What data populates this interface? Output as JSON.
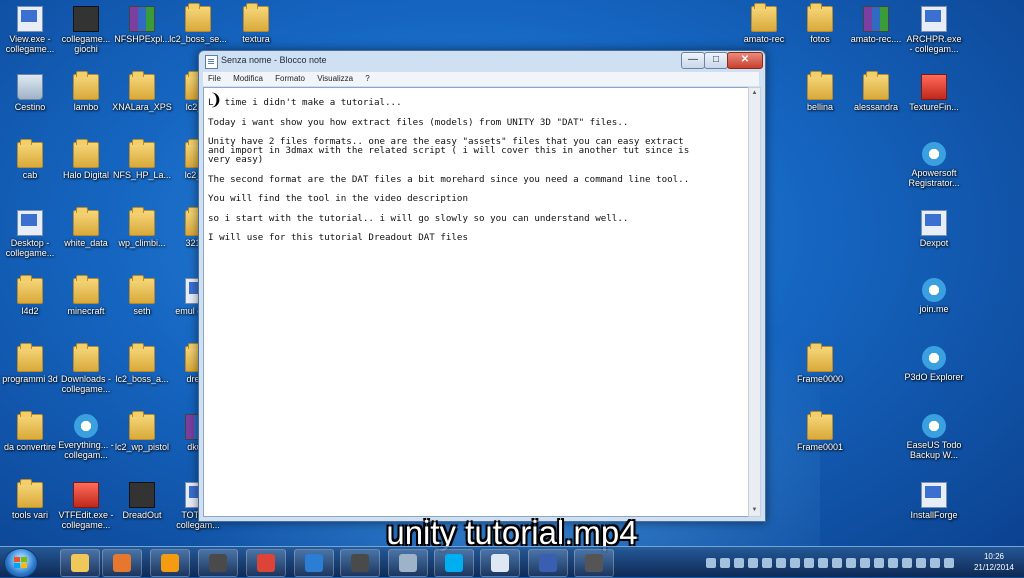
{
  "desktop": {
    "left_icons": [
      {
        "label": "View.exe - collegame...",
        "icon": "exe"
      },
      {
        "label": "collegame... giochi",
        "icon": "dark"
      },
      {
        "label": "NFSHPExpl...",
        "icon": "rar"
      },
      {
        "label": "lc2_boss_se...",
        "icon": "folder"
      },
      {
        "label": "textura",
        "icon": "folder"
      },
      {
        "label": "Cestino",
        "icon": "bin"
      },
      {
        "label": "lambo",
        "icon": "folder"
      },
      {
        "label": "XNALara_XPS",
        "icon": "folder"
      },
      {
        "label": "lc2_ar",
        "icon": "folder"
      },
      {
        "label": "cab",
        "icon": "folder"
      },
      {
        "label": "Halo Digital",
        "icon": "folder"
      },
      {
        "label": "NFS_HP_La...",
        "icon": "folder"
      },
      {
        "label": "lc2_bo",
        "icon": "folder"
      },
      {
        "label": "Desktop - collegame...",
        "icon": "exe"
      },
      {
        "label": "white_data",
        "icon": "folder"
      },
      {
        "label": "wp_climbi...",
        "icon": "folder"
      },
      {
        "label": "32151",
        "icon": "folder"
      },
      {
        "label": "l4d2",
        "icon": "folder"
      },
      {
        "label": "minecraft",
        "icon": "folder"
      },
      {
        "label": "seth",
        "icon": "folder"
      },
      {
        "label": "emul colleg",
        "icon": "exe"
      },
      {
        "label": "programmi 3d",
        "icon": "folder"
      },
      {
        "label": "Downloads - collegame...",
        "icon": "folder"
      },
      {
        "label": "lc2_boss_a...",
        "icon": "folder"
      },
      {
        "label": "dread",
        "icon": "folder"
      },
      {
        "label": "da convertire",
        "icon": "folder"
      },
      {
        "label": "Everything... - collegam...",
        "icon": "app"
      },
      {
        "label": "lc2_wp_pistol",
        "icon": "folder"
      },
      {
        "label": "dkunl",
        "icon": "rar"
      },
      {
        "label": "tools vari",
        "icon": "folder"
      },
      {
        "label": "VTFEdit.exe - collegame...",
        "icon": "red"
      },
      {
        "label": "DreadOut",
        "icon": "dark"
      },
      {
        "label": "TOTAL - collegam...",
        "icon": "exe"
      }
    ],
    "right_icons": [
      {
        "label": "amato-rec",
        "icon": "folder"
      },
      {
        "label": "fotos",
        "icon": "folder"
      },
      {
        "label": "amato-rec....",
        "icon": "rar"
      },
      {
        "label": "ARCHPR.exe - collegam...",
        "icon": "exe"
      },
      {
        "label": "bellina",
        "icon": "folder"
      },
      {
        "label": "alessandra",
        "icon": "folder"
      },
      {
        "label": "TextureFin...",
        "icon": "red"
      },
      {
        "label": "Apowersoft Registrator...",
        "icon": "app"
      },
      {
        "label": "Dexpot",
        "icon": "exe"
      },
      {
        "label": "join.me",
        "icon": "app"
      },
      {
        "label": "Frame0000",
        "icon": "folder"
      },
      {
        "label": "P3dO Explorer",
        "icon": "app"
      },
      {
        "label": "Frame0001",
        "icon": "folder"
      },
      {
        "label": "EaseUS Todo Backup W...",
        "icon": "app"
      },
      {
        "label": "InstallForge",
        "icon": "exe"
      }
    ]
  },
  "notepad": {
    "title": "Senza nome - Blocco note",
    "menu": [
      "File",
      "Modifica",
      "Formato",
      "Visualizza",
      "?"
    ],
    "cursor_glyph": "❩",
    "lines": [
      "L  time i didn't make a tutorial...",
      "Today i want show you how extract files (models) from UNITY 3D \"DAT\" files..",
      "Unity have 2 files formats.. one are the easy \"assets\" files that you can easy extract\nand import in 3dmax with the related script ( i will cover this in another tut since is\nvery easy)",
      "The second format are the DAT files a bit morehard since you need a command line tool..",
      "You will find the tool in the video description",
      "so i start with the tutorial.. i will go slowly so you can understand well..",
      "I will use for this tutorial Dreadout DAT files"
    ]
  },
  "caption": "unity tutorial.mp4",
  "taskbar": {
    "pinned": [
      {
        "name": "explorer",
        "color": "#f0c85a"
      },
      {
        "name": "firefox",
        "color": "#e8772e"
      },
      {
        "name": "media-player",
        "color": "#f39c12"
      },
      {
        "name": "app-g1",
        "color": "#4a4a4a"
      },
      {
        "name": "chrome",
        "color": "#db4437"
      },
      {
        "name": "app-lightning",
        "color": "#2a7fd4"
      },
      {
        "name": "app-g2",
        "color": "#4a4a4a"
      },
      {
        "name": "app-printer",
        "color": "#9fb3c8"
      },
      {
        "name": "skype",
        "color": "#00aff0"
      },
      {
        "name": "notepad",
        "color": "#dfe8f2"
      },
      {
        "name": "save",
        "color": "#3b5fb0"
      },
      {
        "name": "camera",
        "color": "#555555"
      }
    ],
    "clock_time": "10:26",
    "clock_date": "21/12/2014"
  }
}
